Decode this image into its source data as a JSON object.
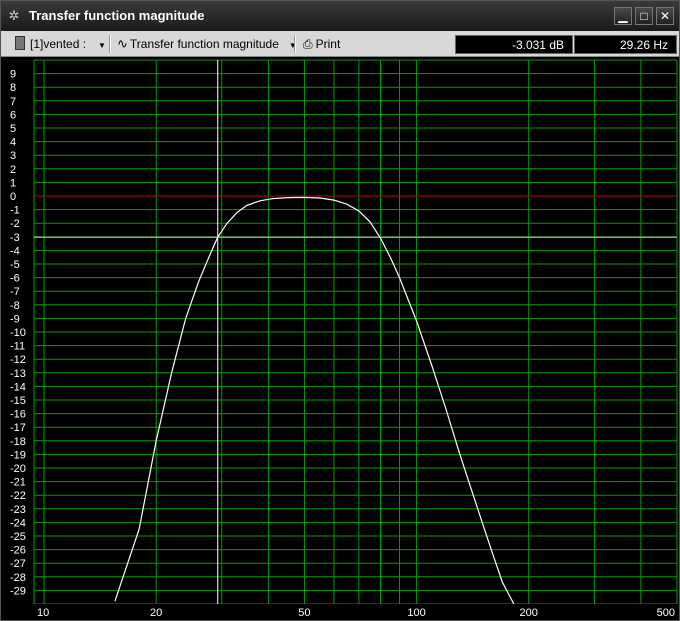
{
  "window": {
    "title": "Transfer function magnitude",
    "minimize_glyph": "▁",
    "maximize_glyph": "□",
    "close_glyph": "✕"
  },
  "toolbar": {
    "dataset_label": "[1]vented :",
    "mode_label": "Transfer function magnitude",
    "print_label": "Print",
    "readout_db": "-3.031 dB",
    "readout_hz": "29.26 Hz"
  },
  "icons": {
    "app": "gear-icon",
    "dataset": "speaker-icon",
    "mode": "wave-icon",
    "print": "printer-icon"
  },
  "colors": {
    "grid": "#00a000",
    "curve": "#ffffff",
    "zero_line": "#c00000",
    "cursor_h": "#ff9fff",
    "cursor_v": "#ffffff"
  },
  "chart_data": {
    "type": "line",
    "xscale": "log",
    "xlim": [
      9.4,
      500
    ],
    "ylim": [
      -30,
      10
    ],
    "xticks": [
      10,
      20,
      50,
      100,
      200,
      500
    ],
    "yticks": [
      9,
      8,
      7,
      6,
      5,
      4,
      3,
      2,
      1,
      0,
      -1,
      -2,
      -3,
      -4,
      -5,
      -6,
      -7,
      -8,
      -9,
      -10,
      -11,
      -12,
      -13,
      -14,
      -15,
      -16,
      -17,
      -18,
      -19,
      -20,
      -21,
      -22,
      -23,
      -24,
      -25,
      -26,
      -27,
      -28,
      -29
    ],
    "grid": true,
    "cursor": {
      "x": 29.26,
      "y": -3.031
    },
    "reference_y": 0,
    "series": [
      {
        "x": [
          15.5,
          18,
          20,
          22,
          24,
          26,
          28,
          29.26,
          31,
          33,
          35,
          38,
          41,
          45,
          50,
          55,
          60,
          65,
          70,
          75,
          80,
          85,
          90,
          100,
          110,
          120,
          130,
          140,
          150,
          160,
          170,
          180,
          190
        ],
        "values": [
          -29.8,
          -24.5,
          -18,
          -13,
          -9,
          -6.3,
          -4.2,
          -3.031,
          -2,
          -1.2,
          -0.7,
          -0.35,
          -0.2,
          -0.12,
          -0.1,
          -0.15,
          -0.3,
          -0.6,
          -1.1,
          -1.9,
          -3.1,
          -4.5,
          -6,
          -9.2,
          -12.5,
          -15.7,
          -18.8,
          -21.5,
          -24,
          -26.3,
          -28.4,
          -29.7,
          -31
        ]
      }
    ]
  }
}
